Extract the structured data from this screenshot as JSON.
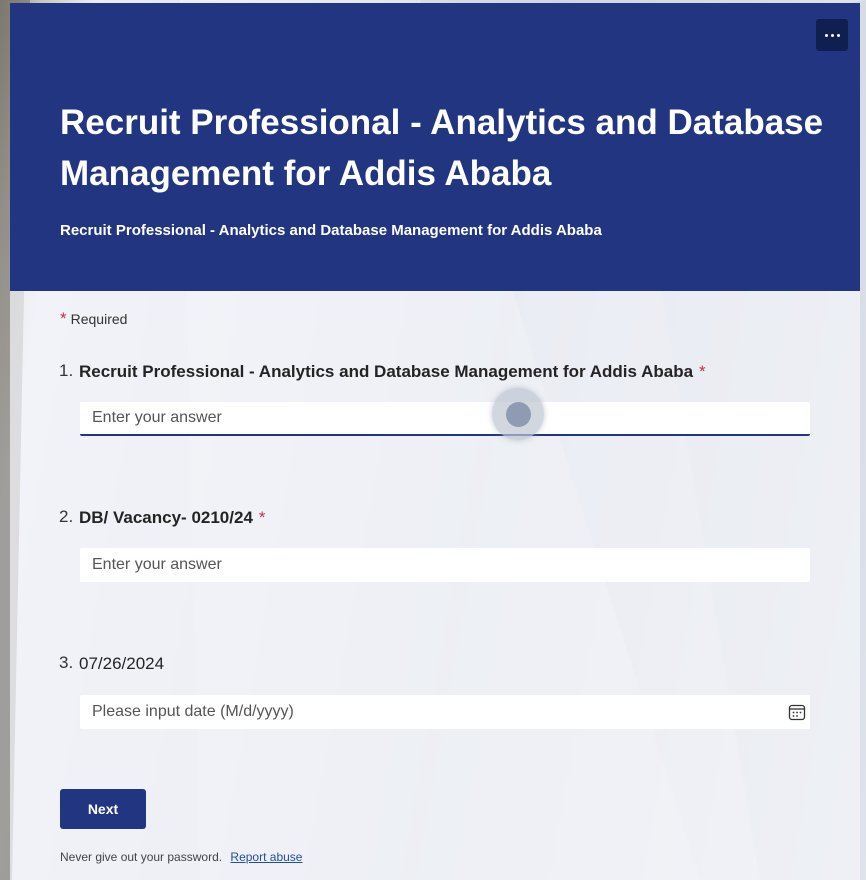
{
  "header": {
    "title": "Recruit Professional - Analytics and Database Management for Addis Ababa",
    "subtitle": "Recruit Professional - Analytics and Database Management for Addis Ababa",
    "more_icon": "more-options-icon"
  },
  "required_note": {
    "star": "*",
    "label": "Required"
  },
  "questions": [
    {
      "number": "1.",
      "text": "Recruit Professional - Analytics and Database Management for Addis Ababa",
      "required_star": "*",
      "placeholder": "Enter your answer"
    },
    {
      "number": "2.",
      "text": "DB/ Vacancy- 0210/24",
      "required_star": "*",
      "placeholder": "Enter your answer"
    },
    {
      "number": "3.",
      "text": "07/26/2024",
      "placeholder": "Please input date (M/d/yyyy)",
      "icon": "calendar-icon"
    }
  ],
  "actions": {
    "next_label": "Next"
  },
  "footer": {
    "note": "Never give out your password.",
    "report_link": "Report abuse"
  },
  "colors": {
    "accent": "#223580",
    "required": "#c4314b",
    "link": "#1f4fa3"
  }
}
